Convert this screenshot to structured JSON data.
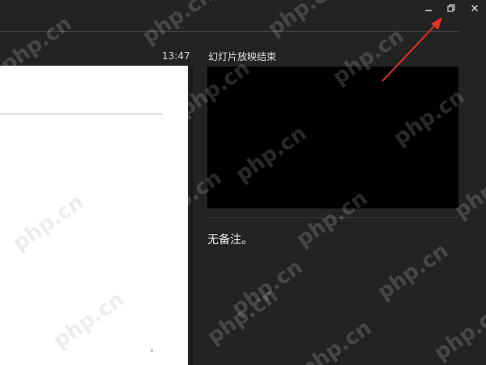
{
  "window": {
    "controls": {
      "minimize_icon": "minimize-icon",
      "restore_icon": "restore-icon",
      "close_icon": "close-icon"
    }
  },
  "presenter": {
    "elapsed_time": "13:47",
    "next_slide_label": "幻灯片放映结束",
    "notes_text": "无备注。"
  },
  "watermark": {
    "text": "php.cn"
  },
  "colors": {
    "background": "#232323",
    "slide": "#ffffff",
    "preview": "#000000",
    "annotation_arrow": "#e0302a"
  }
}
